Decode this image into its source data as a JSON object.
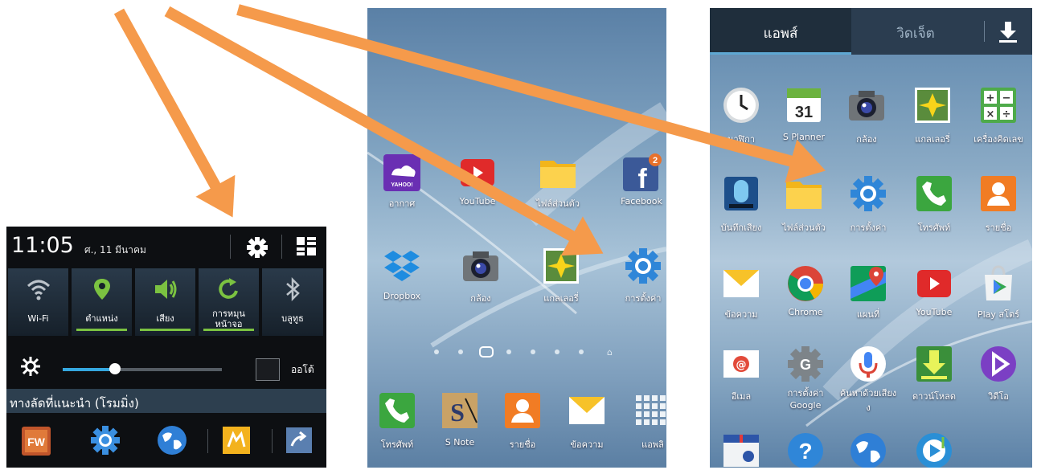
{
  "shade": {
    "clock": "11:05",
    "date": "ศ., 11 มีนาคม",
    "toggles": [
      {
        "label": "Wi-Fi",
        "icon": "wifi-icon",
        "active": false
      },
      {
        "label": "ตำแหน่ง",
        "icon": "location-icon",
        "active": true
      },
      {
        "label": "เสียง",
        "icon": "sound-icon",
        "active": true
      },
      {
        "label": "การหมุน",
        "label2": "หน้าจอ",
        "icon": "rotate-icon",
        "active": true
      },
      {
        "label": "บลูทูธ",
        "icon": "bluetooth-icon",
        "active": false
      }
    ],
    "brightness_level": 0.33,
    "auto_label": "ออโต้",
    "suggestions_title": "ทางลัดที่แนะนำ (โรมมิ่ง)",
    "suggested_apps": [
      "fw-icon",
      "settings-icon",
      "globe-icon",
      "app-icon",
      "share-icon"
    ],
    "colors": {
      "accent_green": "#7bc241",
      "slider_blue": "#35a8e0"
    }
  },
  "home": {
    "rows": [
      [
        {
          "label": "อากาศ",
          "icon": "yahoo-weather-icon"
        },
        {
          "label": "YouTube",
          "icon": "youtube-icon"
        },
        {
          "label": "ไฟล์ส่วนตัว",
          "icon": "folder-icon"
        },
        {
          "label": "Facebook",
          "icon": "facebook-icon",
          "badge": "2"
        }
      ],
      [
        {
          "label": "Dropbox",
          "icon": "dropbox-icon"
        },
        {
          "label": "กล้อง",
          "icon": "camera-icon"
        },
        {
          "label": "แกลเลอรี่",
          "icon": "gallery-icon"
        },
        {
          "label": "การตั้งค่า",
          "icon": "settings-icon"
        }
      ]
    ],
    "dock": [
      {
        "label": "โทรศัพท์",
        "icon": "phone-icon"
      },
      {
        "label": "S Note",
        "icon": "snote-icon"
      },
      {
        "label": "รายชื่อ",
        "icon": "contacts-icon"
      },
      {
        "label": "ข้อความ",
        "icon": "messages-icon"
      },
      {
        "label": "แอพลิ",
        "icon": "apps-grid-icon"
      }
    ]
  },
  "drawer": {
    "tab_apps": "แอพส์",
    "tab_widgets": "วิดเจ็ต",
    "rows": [
      [
        {
          "label": "นาฬิกา",
          "icon": "clock-icon"
        },
        {
          "label": "S Planner",
          "icon": "calendar-icon",
          "text": "31"
        },
        {
          "label": "กล้อง",
          "icon": "camera-icon"
        },
        {
          "label": "แกลเลอรี่",
          "icon": "gallery-icon"
        },
        {
          "label": "เครื่องคิดเลข",
          "icon": "calculator-icon"
        }
      ],
      [
        {
          "label": "บันทึกเสียง",
          "icon": "voice-recorder-icon"
        },
        {
          "label": "ไฟล์ส่วนตัว",
          "icon": "folder-icon"
        },
        {
          "label": "การตั้งค่า",
          "icon": "settings-icon"
        },
        {
          "label": "โทรศัพท์",
          "icon": "phone-icon"
        },
        {
          "label": "รายชื่อ",
          "icon": "contacts-icon"
        }
      ],
      [
        {
          "label": "ข้อความ",
          "icon": "messages-icon"
        },
        {
          "label": "Chrome",
          "icon": "chrome-icon"
        },
        {
          "label": "แผนที่",
          "icon": "maps-icon"
        },
        {
          "label": "YouTube",
          "icon": "youtube-icon"
        },
        {
          "label": "Play สโตร์",
          "icon": "play-store-icon"
        }
      ],
      [
        {
          "label": "อีเมล",
          "icon": "email-icon"
        },
        {
          "label": "การตั้งค่า",
          "label2": "Google",
          "icon": "google-settings-icon"
        },
        {
          "label": "ค้นหาด้วยเสียง",
          "label2": "ง",
          "icon": "voice-search-icon"
        },
        {
          "label": "ดาวน์โหลด",
          "icon": "downloads-icon"
        },
        {
          "label": "วิดีโอ",
          "icon": "video-icon"
        }
      ],
      [
        {
          "label": "",
          "icon": "tv-icon"
        },
        {
          "label": "",
          "icon": "help-icon"
        },
        {
          "label": "",
          "icon": "globe-icon"
        },
        {
          "label": "",
          "icon": "music-icon"
        }
      ]
    ]
  },
  "arrow_color": "#f59a4b"
}
